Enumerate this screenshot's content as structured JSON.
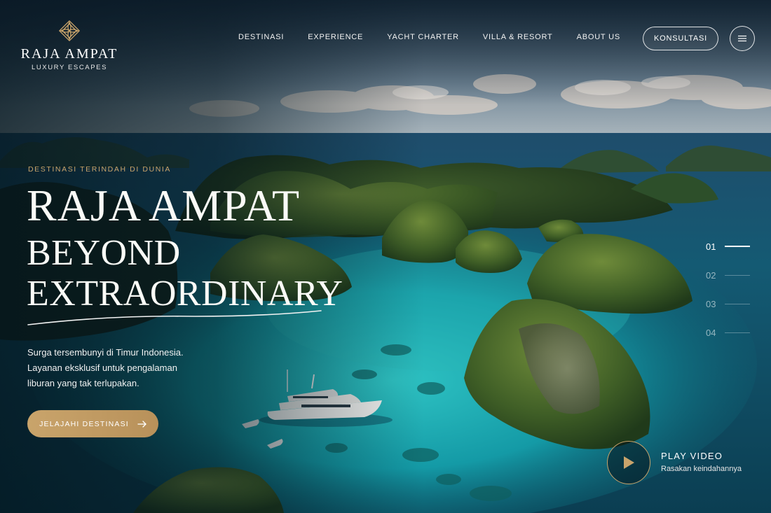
{
  "brand": {
    "title": "RAJA AMPAT",
    "subtitle": "LUXURY ESCAPES",
    "icon": "ornament-logo-icon",
    "accent_color": "#c9a46b"
  },
  "nav": {
    "items": [
      {
        "label": "DESTINASI"
      },
      {
        "label": "EXPERIENCE"
      },
      {
        "label": "YACHT CHARTER"
      },
      {
        "label": "VILLA & RESORT"
      },
      {
        "label": "ABOUT US"
      }
    ],
    "cta_label": "KONSULTASI",
    "menu_icon": "hamburger-icon"
  },
  "hero": {
    "eyebrow": "DESTINASI TERINDAH DI DUNIA",
    "headline_line1": "RAJA AMPAT",
    "headline_line2": "BEYOND",
    "headline_line3": "EXTRAORDINARY",
    "description_lines": [
      "Surga tersembunyi di Timur Indonesia.",
      "Layanan eksklusif untuk pengalaman",
      "liburan yang tak terlupakan."
    ],
    "cta_label": "JELAJAHI DESTINASI",
    "cta_icon": "arrow-right-icon"
  },
  "slides": {
    "items": [
      {
        "label": "01",
        "active": true
      },
      {
        "label": "02",
        "active": false
      },
      {
        "label": "03",
        "active": false
      },
      {
        "label": "04",
        "active": false
      }
    ]
  },
  "video": {
    "title": "PLAY VIDEO",
    "subtitle": "Rasakan keindahannya",
    "icon": "play-icon"
  }
}
